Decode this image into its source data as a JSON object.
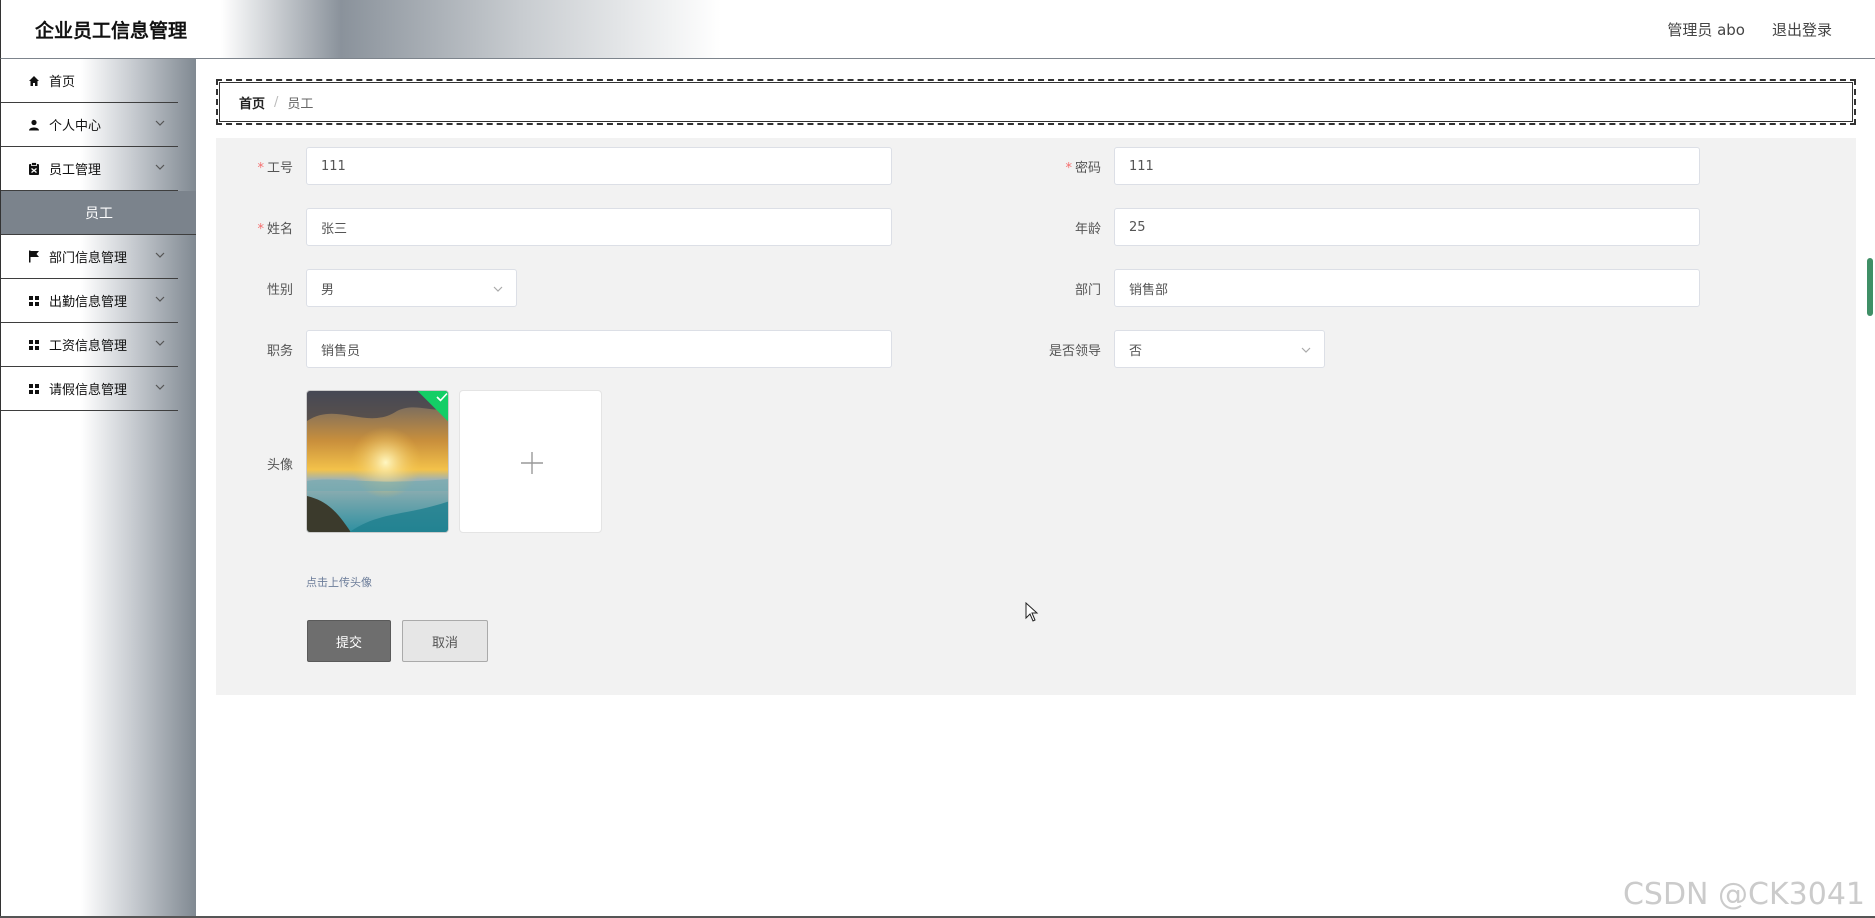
{
  "header": {
    "title": "企业员工信息管理",
    "user": "管理员 abo",
    "logout": "退出登录"
  },
  "sidebar": {
    "items": [
      {
        "label": "首页",
        "icon": "home-icon"
      },
      {
        "label": "个人中心",
        "icon": "user-icon",
        "expandable": true
      },
      {
        "label": "员工管理",
        "icon": "clipboard-icon",
        "expandable": true,
        "expanded": true
      },
      {
        "label": "部门信息管理",
        "icon": "flag-icon",
        "expandable": true
      },
      {
        "label": "出勤信息管理",
        "icon": "grid-icon",
        "expandable": true
      },
      {
        "label": "工资信息管理",
        "icon": "grid-icon",
        "expandable": true
      },
      {
        "label": "请假信息管理",
        "icon": "grid-icon",
        "expandable": true
      }
    ],
    "subitem": "员工"
  },
  "breadcrumb": {
    "home": "首页",
    "separator": "/",
    "current": "员工"
  },
  "form": {
    "job_no": {
      "label": "工号",
      "value": "111",
      "required": true
    },
    "password": {
      "label": "密码",
      "value": "111",
      "required": true
    },
    "name": {
      "label": "姓名",
      "value": "张三",
      "required": true
    },
    "age": {
      "label": "年龄",
      "value": "25"
    },
    "gender": {
      "label": "性别",
      "value": "男"
    },
    "department": {
      "label": "部门",
      "value": "销售部"
    },
    "position": {
      "label": "职务",
      "value": "销售员"
    },
    "is_leader": {
      "label": "是否领导",
      "value": "否"
    },
    "avatar": {
      "label": "头像",
      "tip": "点击上传头像"
    },
    "submit": "提交",
    "cancel": "取消"
  },
  "required_mark": "*",
  "watermark": "CSDN @CK3041",
  "colors": {
    "required": "#f56c6c",
    "submit_bg": "#6e6e6e",
    "sidebar_active": "#7b838c",
    "upload_success": "#13ce66"
  }
}
